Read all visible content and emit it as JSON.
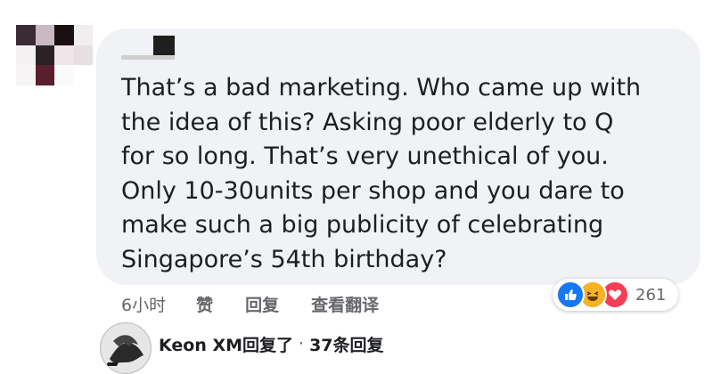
{
  "comment": {
    "text": "That’s a bad marketing. Who came up with\nthe idea of this? Asking poor  elderly to Q\nfor so long. That’s very unethical of you.\nOnly 10-30units per shop and you dare to\nmake such a big publicity of celebrating\nSingapore’s 54th birthday?"
  },
  "actions": {
    "time": "6小时",
    "like": "赞",
    "reply": "回复",
    "translate": "查看翻译"
  },
  "reactions": {
    "count": "261",
    "types": [
      "like-icon",
      "haha-icon",
      "love-icon"
    ],
    "colors": {
      "like": "#1877f2",
      "haha": "#f7b125",
      "love": "#f33e58"
    }
  },
  "reply_preview": {
    "name": "Keon XM回复了",
    "separator": "·",
    "count": "37条回复"
  }
}
